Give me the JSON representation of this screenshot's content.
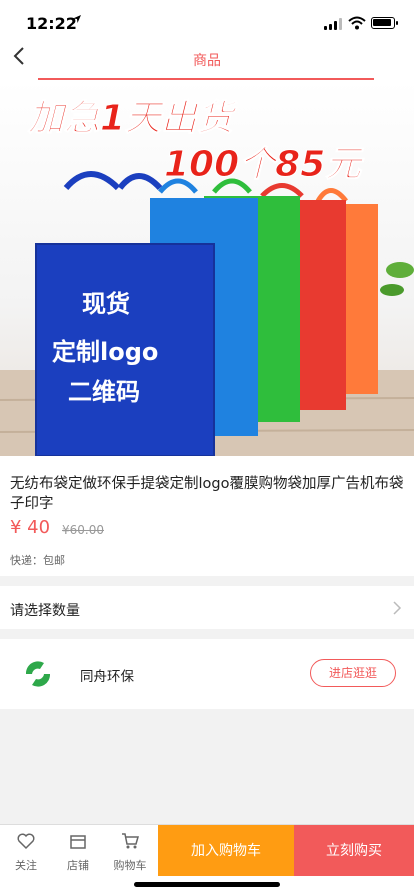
{
  "status": {
    "time": "12:22",
    "location_icon": "location-arrow-icon"
  },
  "nav": {
    "title": "商品",
    "back_icon": "chevron-left-icon"
  },
  "hero": {
    "headline1": "加急1天出货",
    "headline2": "100个85元",
    "bag_text": [
      "现货",
      "定制logo",
      "二维码"
    ]
  },
  "product": {
    "name": "无纺布袋定做环保手提袋定制logo覆膜购物袋加厚广告机布袋子印字",
    "price": "¥ 40",
    "old_price": "¥60.00",
    "shipping": "快递：包邮"
  },
  "quantity": {
    "label": "请选择数量"
  },
  "shop": {
    "name": "同舟环保",
    "visit_label": "进店逛逛"
  },
  "bottom_bar": {
    "tabs": [
      {
        "label": "关注",
        "icon": "heart-icon"
      },
      {
        "label": "店铺",
        "icon": "store-icon"
      },
      {
        "label": "购物车",
        "icon": "cart-icon"
      }
    ],
    "add_to_cart": "加入购物车",
    "buy_now": "立刻购买"
  },
  "colors": {
    "accent": "#f25a5a",
    "orange": "#ff9c12"
  }
}
